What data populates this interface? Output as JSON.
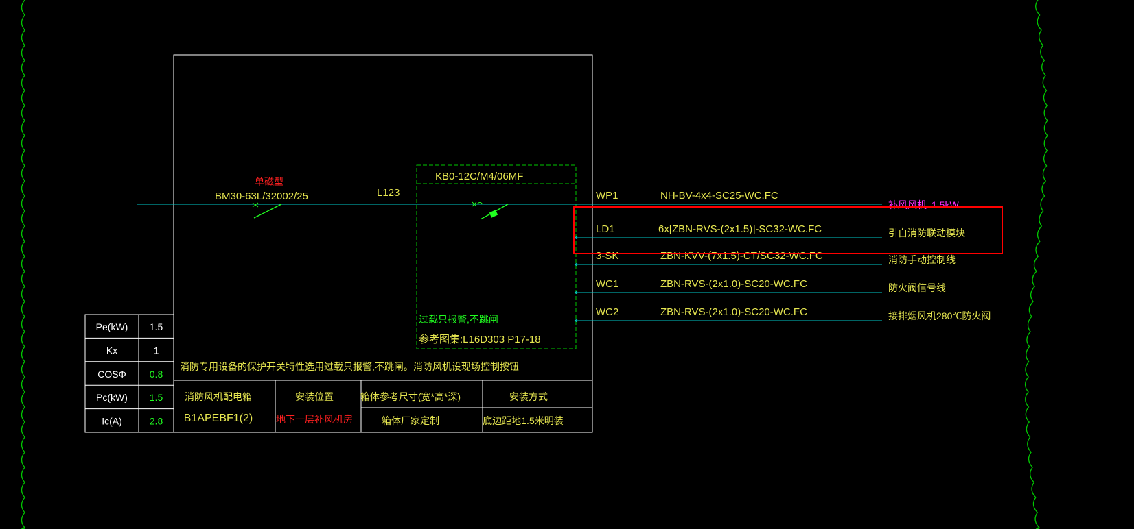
{
  "colors": {
    "background": "#000000",
    "frame": "#ffffff",
    "cloud": "#00c800",
    "conductor": "#00c8c8",
    "text_yellow": "#e6e650",
    "text_red": "#ff2020",
    "text_green": "#20ff20",
    "text_magenta": "#ff30ff",
    "text_white": "#ffffff",
    "highlight": "#ff0000"
  },
  "incoming": {
    "breaker_type_note": "单磁型",
    "breaker_model": "BM30-63L/32002/25",
    "phase": "L123"
  },
  "protection_box": {
    "device_model": "KB0-12C/M4/06MF",
    "note": "过载只报警,不跳闸",
    "reference": "参考图集:L16D303 P17-18"
  },
  "circuits": [
    {
      "id": "WP1",
      "cable": "NH-BV-4x4-SC25-WC.FC",
      "destination": "补风风机",
      "extra": "1.5kW"
    },
    {
      "id": "LD1",
      "cable": "6x[ZBN-RVS-(2x1.5)]-SC32-WC.FC",
      "destination": "引自消防联动模块",
      "extra": ""
    },
    {
      "id": "3-SK",
      "cable": "ZBN-KVV-(7x1.5)-CT/SC32-WC.FC",
      "destination": "消防手动控制线",
      "extra": ""
    },
    {
      "id": "WC1",
      "cable": "ZBN-RVS-(2x1.0)-SC20-WC.FC",
      "destination": "防火阀信号线",
      "extra": ""
    },
    {
      "id": "WC2",
      "cable": "ZBN-RVS-(2x1.0)-SC20-WC.FC",
      "destination": "接排烟风机280℃防火阀",
      "extra": ""
    }
  ],
  "load_table": [
    {
      "label": "Pe(kW)",
      "value": "1.5"
    },
    {
      "label": "Kx",
      "value": "1"
    },
    {
      "label": "COSΦ",
      "value": "0.8"
    },
    {
      "label": "Pc(kW)",
      "value": "1.5"
    },
    {
      "label": "Ic(A)",
      "value": "2.8"
    }
  ],
  "panel_note": "消防专用设备的保护开关特性选用过载只报警,不跳闸。消防风机设现场控制按钮",
  "title_block": {
    "panel_name": "消防风机配电箱",
    "panel_code": "B1APEBF1(2)",
    "location_header": "安装位置",
    "location_value": "地下一层补风机房",
    "size_header": "箱体参考尺寸(宽*高*深)",
    "size_value": "箱体厂家定制",
    "mount_header": "安装方式",
    "mount_value": "底边距地1.5米明装"
  }
}
